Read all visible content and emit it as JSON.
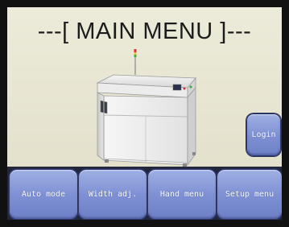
{
  "screen": {
    "title": "---[ MAIN MENU ]---"
  },
  "machine_image": {
    "icon": "conveyor-machine-illustration"
  },
  "login_button": {
    "label": "Login"
  },
  "menu_buttons": [
    {
      "label": "Auto mode"
    },
    {
      "label": "Width adj."
    },
    {
      "label": "Hand menu"
    },
    {
      "label": "Setup menu"
    }
  ],
  "colors": {
    "screen_background": "#e6e4d0",
    "button_fill": "#7f91d4",
    "button_border": "#2e3a74",
    "button_text": "#ffffff"
  }
}
